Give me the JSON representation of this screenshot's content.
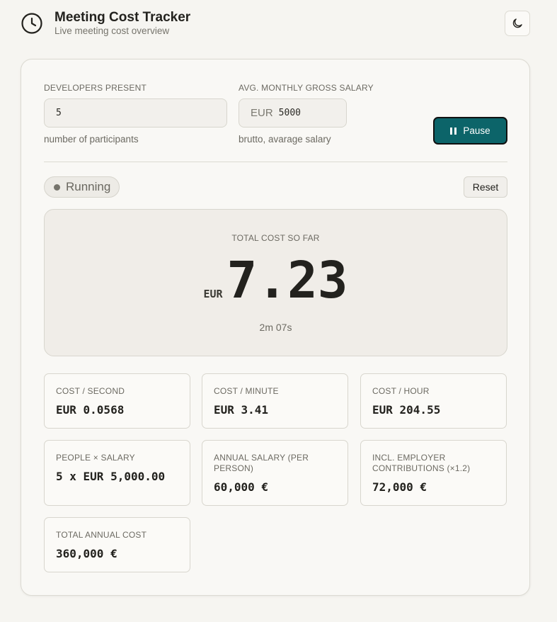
{
  "header": {
    "title": "Meeting Cost Tracker",
    "subtitle": "Live meeting cost overview",
    "logo_icon": "clock-icon",
    "theme_icon": "moon-icon"
  },
  "form": {
    "developers_label": "DEVELOPERS PRESENT",
    "developers_value": "5",
    "developers_hint": "number of participants",
    "salary_label": "AVG. MONTHLY GROSS SALARY",
    "salary_currency": "EUR",
    "salary_value": "5000",
    "salary_hint": "brutto, avarage salary"
  },
  "controls": {
    "pause_label": "Pause",
    "status": "Running",
    "reset_label": "Reset"
  },
  "total": {
    "label": "TOTAL COST SO FAR",
    "currency": "EUR",
    "value": "7.23",
    "elapsed": "2m 07s"
  },
  "stats": [
    {
      "label": "COST / SECOND",
      "value": "EUR 0.0568"
    },
    {
      "label": "COST / MINUTE",
      "value": "EUR 3.41"
    },
    {
      "label": "COST / HOUR",
      "value": "EUR 204.55"
    },
    {
      "label": "PEOPLE × SALARY",
      "value": "5 x EUR 5,000.00"
    },
    {
      "label": "ANNUAL SALARY (PER PERSON)",
      "value": "60,000 €"
    },
    {
      "label": "INCL. EMPLOYER CONTRIBUTIONS (×1.2)",
      "value": "72,000 €"
    },
    {
      "label": "TOTAL ANNUAL COST",
      "value": "360,000 €"
    }
  ],
  "colors": {
    "accent": "#0c6469",
    "background": "#f6f5f1"
  }
}
